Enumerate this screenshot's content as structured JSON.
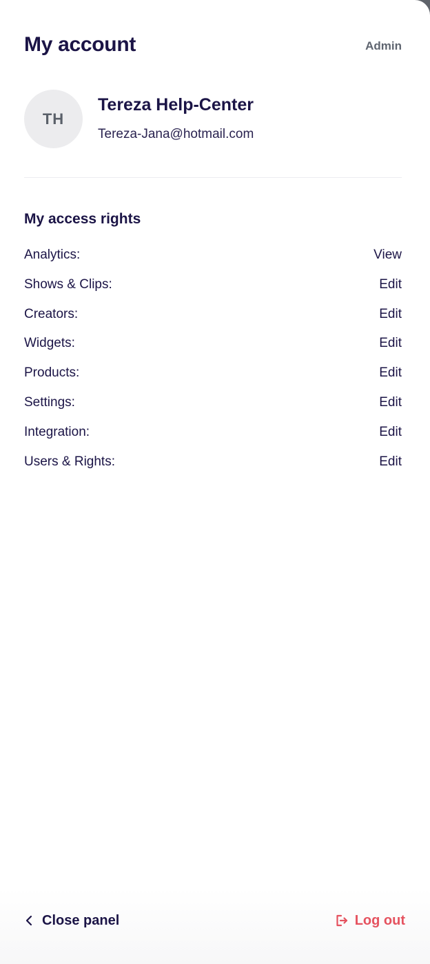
{
  "header": {
    "title": "My account",
    "role": "Admin"
  },
  "profile": {
    "initials": "TH",
    "name": "Tereza Help-Center",
    "email": "Tereza-Jana@hotmail.com"
  },
  "access_rights": {
    "title": "My access rights",
    "items": [
      {
        "label": "Analytics:",
        "value": "View"
      },
      {
        "label": "Shows & Clips:",
        "value": "Edit"
      },
      {
        "label": "Creators:",
        "value": "Edit"
      },
      {
        "label": "Widgets:",
        "value": "Edit"
      },
      {
        "label": "Products:",
        "value": "Edit"
      },
      {
        "label": "Settings:",
        "value": "Edit"
      },
      {
        "label": "Integration:",
        "value": "Edit"
      },
      {
        "label": "Users & Rights:",
        "value": "Edit"
      }
    ]
  },
  "footer": {
    "close_label": "Close panel",
    "close_icon": "chevron-left-icon",
    "logout_label": "Log out",
    "logout_icon": "logout-icon"
  },
  "colors": {
    "primary_text": "#1b1446",
    "muted_text": "#5f6570",
    "danger": "#e5525f",
    "avatar_bg": "#ececee"
  }
}
